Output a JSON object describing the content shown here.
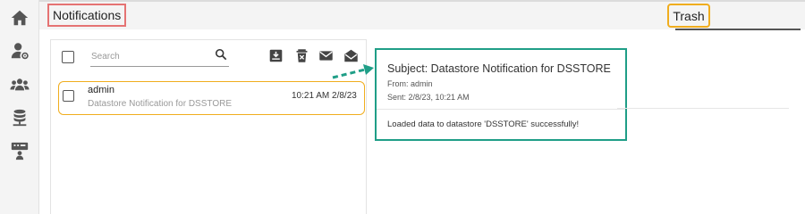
{
  "header": {
    "title": "Notifications",
    "tab_trash": "Trash"
  },
  "sidebar": {
    "items": [
      {
        "icon": "home-icon"
      },
      {
        "icon": "user-settings-icon"
      },
      {
        "icon": "users-group-icon"
      },
      {
        "icon": "database-icon"
      },
      {
        "icon": "presenter-icon"
      }
    ]
  },
  "list": {
    "search_placeholder": "Search",
    "toolbar_icons": [
      "download-icon",
      "delete-icon",
      "mark-unread-icon",
      "mark-read-icon"
    ],
    "items": [
      {
        "from": "admin",
        "subject": "Datastore Notification for DSSTORE",
        "time": "10:21 AM 2/8/23"
      }
    ]
  },
  "detail": {
    "subject": "Subject: Datastore Notification for DSSTORE",
    "from": "From: admin",
    "sent": "Sent: 2/8/23, 10:21 AM",
    "body": "Loaded data to datastore 'DSSTORE' successfully!"
  },
  "colors": {
    "title_highlight": "#e57373",
    "trash_highlight": "#f0ad1e",
    "item_highlight": "#f0ad1e",
    "detail_highlight": "#1f9e87",
    "arrow": "#1f9e87"
  }
}
